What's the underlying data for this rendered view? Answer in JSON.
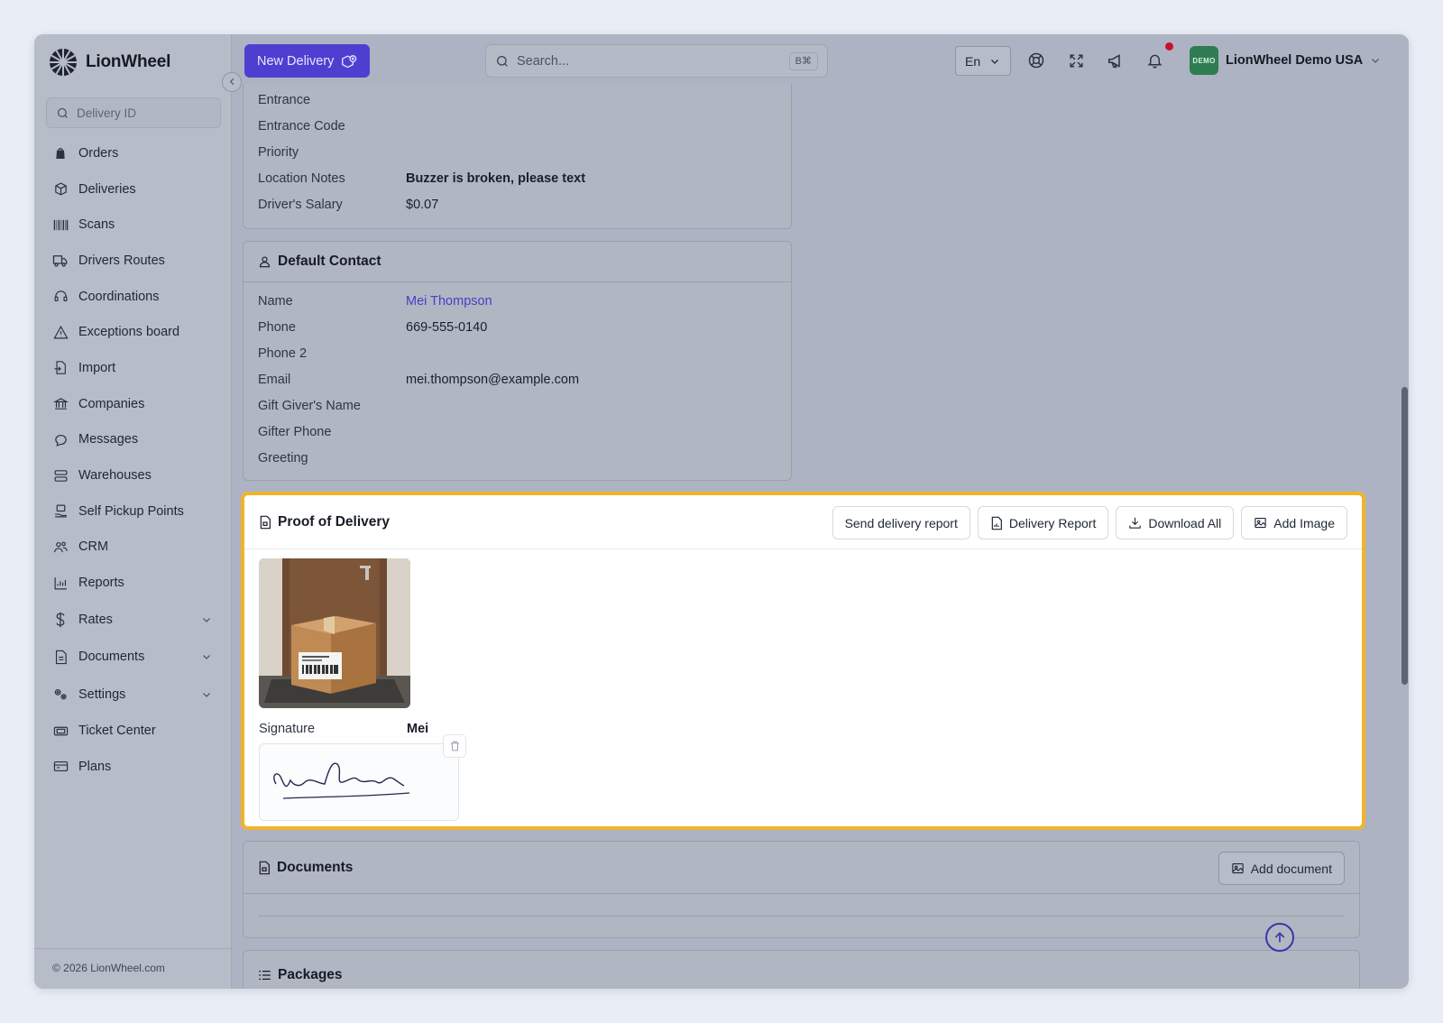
{
  "app": {
    "name": "LionWheel",
    "copyright": "© 2026 LionWheel.com"
  },
  "sidebar": {
    "search_placeholder": "Delivery ID",
    "items": [
      {
        "label": "Orders",
        "icon": "shopping-bag-icon"
      },
      {
        "label": "Deliveries",
        "icon": "box-icon"
      },
      {
        "label": "Scans",
        "icon": "barcode-icon"
      },
      {
        "label": "Drivers Routes",
        "icon": "truck-icon"
      },
      {
        "label": "Coordinations",
        "icon": "headset-icon"
      },
      {
        "label": "Exceptions board",
        "icon": "warning-icon"
      },
      {
        "label": "Import",
        "icon": "file-import-icon"
      },
      {
        "label": "Companies",
        "icon": "bank-icon"
      },
      {
        "label": "Messages",
        "icon": "chat-icon"
      },
      {
        "label": "Warehouses",
        "icon": "warehouse-icon"
      },
      {
        "label": "Self Pickup Points",
        "icon": "pickup-point-icon"
      },
      {
        "label": "CRM",
        "icon": "users-icon"
      },
      {
        "label": "Reports",
        "icon": "chart-icon"
      },
      {
        "label": "Rates",
        "icon": "dollar-icon",
        "expandable": true
      },
      {
        "label": "Documents",
        "icon": "document-icon",
        "expandable": true
      },
      {
        "label": "Settings",
        "icon": "gears-icon",
        "expandable": true
      },
      {
        "label": "Ticket Center",
        "icon": "ticket-icon"
      },
      {
        "label": "Plans",
        "icon": "plans-icon"
      }
    ]
  },
  "topbar": {
    "new_delivery_label": "New Delivery",
    "search_placeholder": "Search...",
    "search_shortcut": "B⌘",
    "language": "En",
    "account_badge": "DEMO",
    "account_name": "LionWheel Demo USA"
  },
  "location_panel": {
    "rows": [
      {
        "key": "Entrance",
        "value": ""
      },
      {
        "key": "Entrance Code",
        "value": ""
      },
      {
        "key": "Priority",
        "value": ""
      },
      {
        "key": "Location Notes",
        "value": "Buzzer is broken, please text"
      },
      {
        "key": "Driver's Salary",
        "value": "$0.07"
      }
    ]
  },
  "contact_panel": {
    "title": "Default Contact",
    "rows": [
      {
        "key": "Name",
        "value": "Mei Thompson"
      },
      {
        "key": "Phone",
        "value": "669-555-0140"
      },
      {
        "key": "Phone 2",
        "value": ""
      },
      {
        "key": "Email",
        "value": "mei.thompson@example.com"
      },
      {
        "key": "Gift Giver's Name",
        "value": ""
      },
      {
        "key": "Gifter Phone",
        "value": ""
      },
      {
        "key": "Greeting",
        "value": ""
      }
    ]
  },
  "proof_of_delivery": {
    "title": "Proof of Delivery",
    "actions": {
      "send_report": "Send delivery report",
      "delivery_report": "Delivery Report",
      "download_all": "Download All",
      "add_image": "Add Image"
    },
    "signature_label": "Signature",
    "signature_name": "Mei"
  },
  "documents_panel": {
    "title": "Documents",
    "add_label": "Add document"
  },
  "packages_panel": {
    "title": "Packages"
  },
  "colors": {
    "accent": "#4f3fd0",
    "highlight": "#f0b429",
    "notification": "#c8102e",
    "demo_badge": "#2f7d52"
  }
}
